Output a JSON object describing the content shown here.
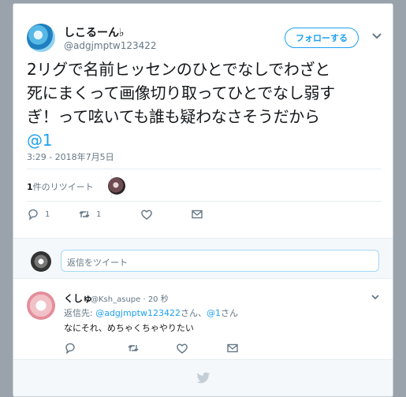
{
  "tweet": {
    "display_name": "しこるーん♭",
    "handle": "@adgjmptw123422",
    "follow_label": "フォローする",
    "text_lines": [
      "2リグで名前ヒッセンのひとでなしでわざと",
      "死にまくって画像切り取ってひとでなし弱す",
      "ぎ！って呟いても誰も疑わなさそうだから"
    ],
    "mention": "@1",
    "timestamp": "3:29 - 2018年7月5日",
    "retweet_count_num": "1",
    "retweet_count_label": "件のリツイート",
    "reply_count": "1",
    "retweet_action_count": "1"
  },
  "reply_box": {
    "placeholder": "返信をツイート"
  },
  "reply": {
    "display_name": "くしゅ",
    "meta": "@Ksh_asupe · 20 秒",
    "replying_prefix": "返信先: ",
    "replying_user1": "@adgjmptw123422",
    "replying_mid": "さん、",
    "replying_user2": "@1",
    "replying_suffix": "さん",
    "text": "なにそれ、めちゃくちゃやりたい"
  },
  "colors": {
    "accent": "#1da1f2",
    "muted": "#657786",
    "background": "#9aa3ab"
  },
  "icons": [
    "chevron-down-icon",
    "reply-icon",
    "retweet-icon",
    "like-icon",
    "message-icon",
    "twitter-bird-icon"
  ]
}
